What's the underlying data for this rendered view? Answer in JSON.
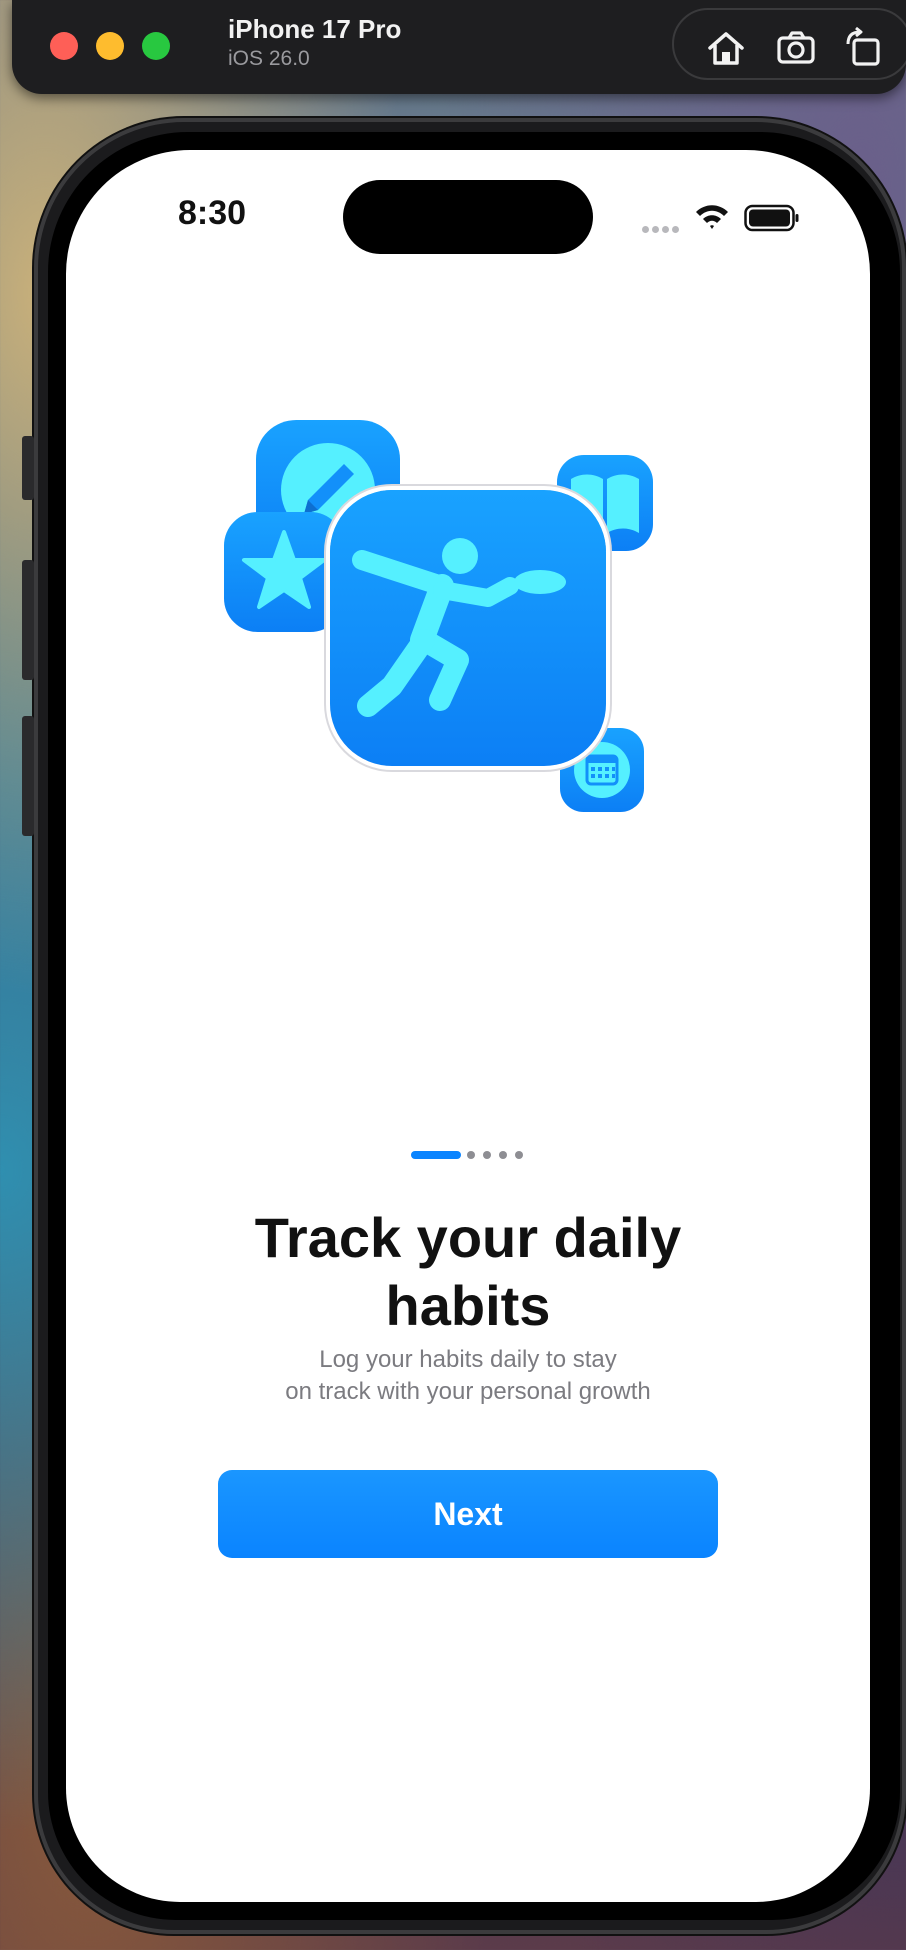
{
  "simulator": {
    "device_name": "iPhone 17 Pro",
    "os_version": "iOS 26.0",
    "toolbar": {
      "home_icon": "home-icon",
      "screenshot_icon": "camera-icon",
      "rotate_icon": "rotate-icon"
    }
  },
  "status_bar": {
    "time": "8:30"
  },
  "onboarding": {
    "illustration_icons": [
      "pencil-icon",
      "star-icon",
      "book-icon",
      "runner-icon",
      "calendar-icon"
    ],
    "page_indicator": {
      "pages": 5,
      "current": 1
    },
    "title_line1": "Track your daily",
    "title_line2": "habits",
    "subtitle_line1": "Log your habits daily to stay",
    "subtitle_line2": "on track with your personal growth",
    "next_button": "Next"
  },
  "colors": {
    "accent": "#0A84FF",
    "icon_glyph": "#55F0FF",
    "subtitle_text": "#7B7B80"
  }
}
